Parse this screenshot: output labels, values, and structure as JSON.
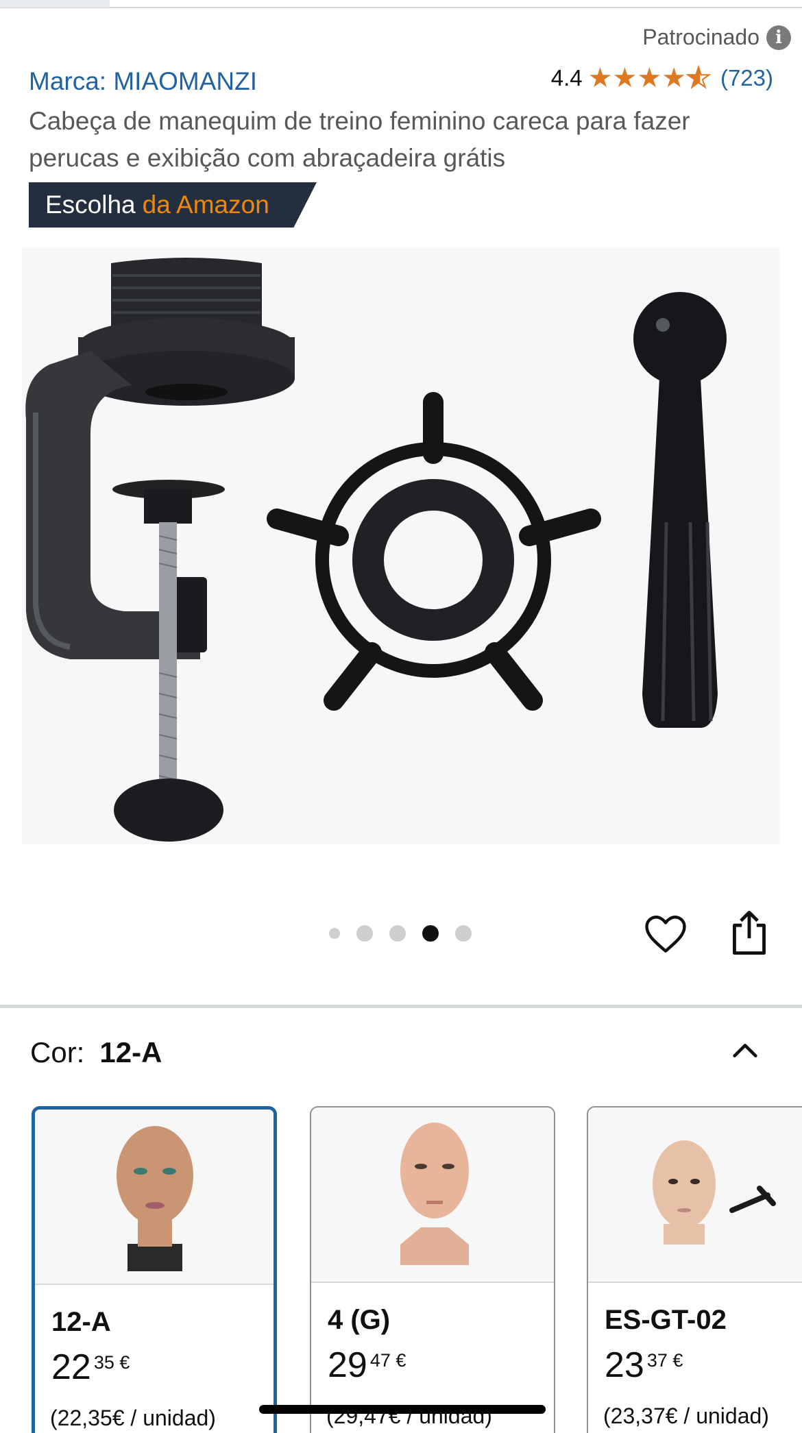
{
  "header": {
    "sponsored_label": "Patrocinado",
    "info_icon": "info-icon"
  },
  "product": {
    "brand": "Marca: MIAOMANZI",
    "rating": "4.4",
    "stars_value": 4.4,
    "rating_count": "(723)",
    "title": "Cabeça de manequim de treino feminino careca para fazer perucas e exibição com abraçadeira grátis",
    "badge_prefix": "Escolha",
    "badge_suffix": "da Amazon"
  },
  "gallery": {
    "image_description_icon": "clamp-ring-pin-image",
    "dot_count": 5,
    "active_dot": 4,
    "favorite_icon": "heart-icon",
    "share_icon": "share-icon"
  },
  "variation": {
    "label": "Cor:",
    "selected": "12-A",
    "collapse_icon": "chevron-up-icon",
    "options": [
      {
        "name": "12-A",
        "whole": "22",
        "fraction": "35 €",
        "unit_price": "(22,35€ / unidad)"
      },
      {
        "name": "4 (G)",
        "whole": "29",
        "fraction": "47 €",
        "unit_price": "(29,47€ / unidad)"
      },
      {
        "name": "ES-GT-02",
        "whole": "23",
        "fraction": "37 €",
        "unit_price": "(23,37€ / unidad)"
      }
    ]
  },
  "colors": {
    "link": "#2162a1",
    "star": "#de7921",
    "badge_bg": "#232f3e",
    "badge_accent": "#f08804",
    "selected_border": "#2162a1"
  }
}
